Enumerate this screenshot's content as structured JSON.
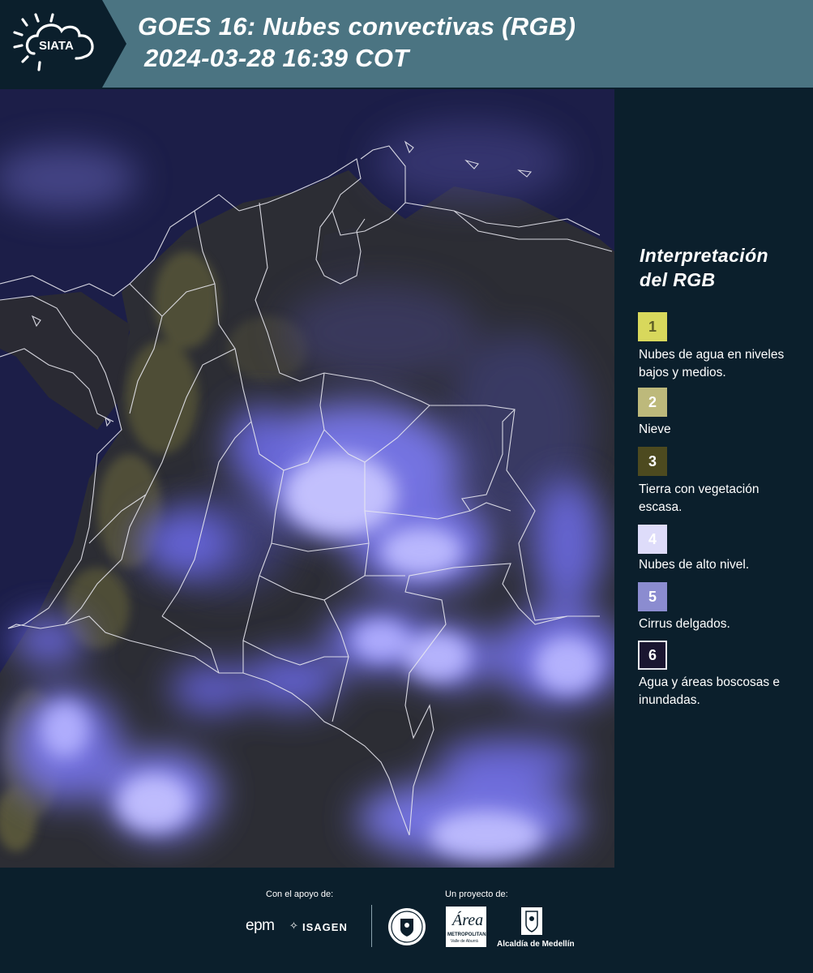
{
  "header": {
    "logo_text": "SIATA",
    "title_line1": "GOES 16: Nubes convectivas (RGB)",
    "title_line2": "2024-03-28 16:39 COT"
  },
  "legend": {
    "title_line1": "Interpretación",
    "title_line2": "del RGB",
    "items": [
      {
        "number": "1",
        "label": "Nubes de agua en niveles bajos y medios.",
        "color": "#d8d85c"
      },
      {
        "number": "2",
        "label": "Nieve",
        "color": "#bdb97b"
      },
      {
        "number": "3",
        "label": "Tierra con vegetación escasa.",
        "color": "#4d4a1f"
      },
      {
        "number": "4",
        "label": "Nubes de alto nivel.",
        "color": "#dedcfa"
      },
      {
        "number": "5",
        "label": "Cirrus delgados.",
        "color": "#8b8cd0"
      },
      {
        "number": "6",
        "label": "Agua y áreas boscosas e inundadas.",
        "color": "#1a1530"
      }
    ]
  },
  "footer": {
    "support_label": "Con el apoyo de:",
    "project_label": "Un proyecto de:",
    "sponsor1": "epm",
    "sponsor2": "ISAGEN",
    "partner1_name": "Área",
    "partner1_sub": "METROPOLITANA",
    "partner1_sub2": "Valle de Aburrá",
    "partner2": "Alcaldía de Medellín"
  },
  "colors": {
    "header_bg": "#4b7482",
    "panel_bg": "#0b1f2c",
    "map_water": "#1d1f4a",
    "cloud_high": "#8c8cff",
    "cloud_top": "#dcdcff",
    "border_lines": "#ffffff"
  }
}
